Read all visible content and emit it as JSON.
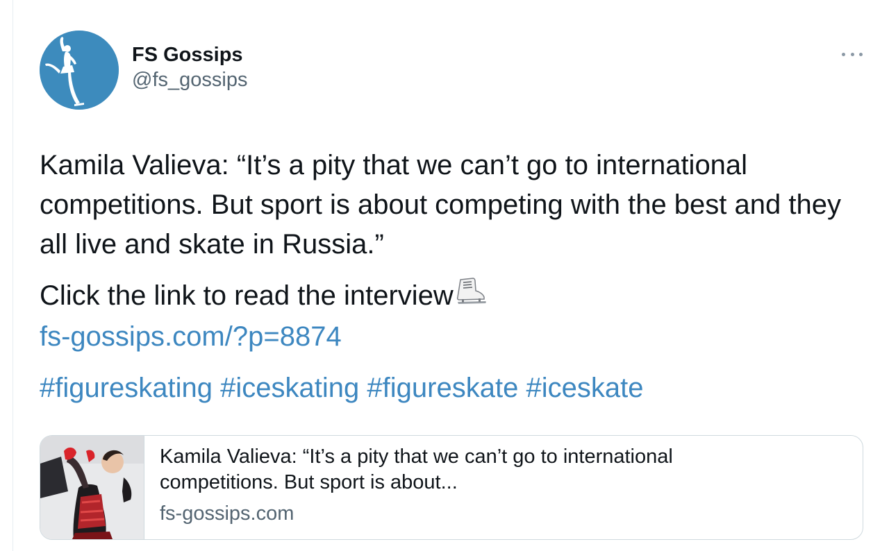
{
  "tweet": {
    "author": {
      "display_name": "FS Gossips",
      "handle": "@fs_gossips",
      "avatar_icon": "figure-skater-icon",
      "avatar_color": "#3d8bbd"
    },
    "more_icon": "more-options-icon",
    "text_quote": "Kamila Valieva: “It’s a pity that we can’t go to international competitions. But sport is about competing with the best and they all live and skate in Russia.”",
    "text_cta": "Click the link to read the interview",
    "cta_emoji": "ice-skate-icon",
    "link": "fs-gossips.com/?p=8874",
    "hashtags": [
      "#figureskating",
      "#iceskating",
      "#figureskate",
      "#iceskate"
    ],
    "link_color": "#3d87c0"
  },
  "card": {
    "title": "Kamila Valieva: “It’s a pity that we can’t go to international competitions. But sport is about...",
    "domain": "fs-gossips.com",
    "image_icon": "skater-photo"
  }
}
